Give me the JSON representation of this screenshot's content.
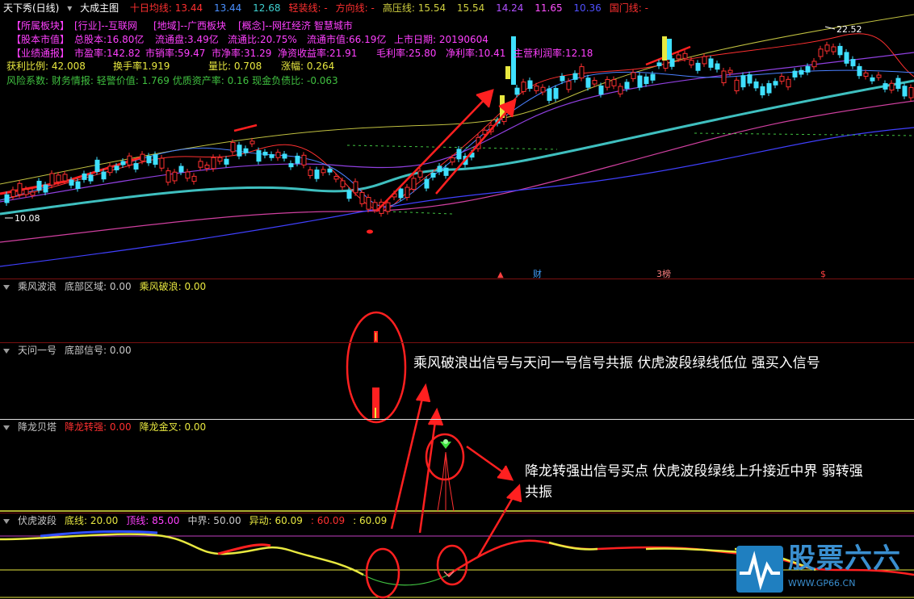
{
  "header": {
    "stock_title": "天下秀(日线)",
    "chart_name": "大成主图",
    "items": [
      {
        "label": "十日均线:",
        "value": "13.44",
        "color": "#ff3030"
      },
      {
        "label": "",
        "value": "13.44",
        "color": "#4a90ff"
      },
      {
        "label": "",
        "value": "12.68",
        "color": "#3fd0d0"
      },
      {
        "label": "轻装线:",
        "value": "-",
        "color": "#ff3030"
      },
      {
        "label": "方向线:",
        "value": "-",
        "color": "#ff3030"
      },
      {
        "label": "高压线:",
        "value": "15.54",
        "color": "#d0d040"
      },
      {
        "label": "",
        "value": "15.54",
        "color": "#d0d040"
      },
      {
        "label": "",
        "value": "14.24",
        "color": "#b050ff"
      },
      {
        "label": "",
        "value": "11.65",
        "color": "#ff50ff"
      },
      {
        "label": "",
        "value": "10.36",
        "color": "#5050ff"
      },
      {
        "label": "国门线:",
        "value": "-",
        "color": "#ff3030"
      }
    ]
  },
  "info_rows": [
    [
      {
        "text": "【所属板块】",
        "color": "#ff40ff"
      },
      {
        "text": "[行业]--互联网",
        "color": "#ff40ff"
      },
      {
        "text": "[地域]--广西板块",
        "color": "#ff40ff"
      },
      {
        "text": "[概念]--网红经济 智慧城市",
        "color": "#ff40ff"
      }
    ],
    [
      {
        "text": "【股本市值】",
        "color": "#ff40ff"
      },
      {
        "text": "总股本:16.80亿",
        "color": "#ff40ff"
      },
      {
        "text": "流通盘:3.49亿",
        "color": "#ff40ff"
      },
      {
        "text": "流通比:20.75%",
        "color": "#ff40ff"
      },
      {
        "text": "流通市值:66.19亿",
        "color": "#ff40ff"
      },
      {
        "text": "上市日期: 20190604",
        "color": "#ff40ff"
      }
    ],
    [
      {
        "text": "【业绩通报】",
        "color": "#ff40ff"
      },
      {
        "text": "市盈率:142.82",
        "color": "#ff40ff"
      },
      {
        "text": "市销率:59.47",
        "color": "#ff40ff"
      },
      {
        "text": "市净率:31.29",
        "color": "#ff40ff"
      },
      {
        "text": "净资收益率:21.91",
        "color": "#ff40ff"
      },
      {
        "text": "毛利率:25.80",
        "color": "#ff40ff"
      },
      {
        "text": "净利率:10.41",
        "color": "#ff40ff"
      },
      {
        "text": "主营利润率:12.18",
        "color": "#ff40ff"
      }
    ],
    [
      {
        "text": "获利比例:  42.008",
        "color": "#e8e840"
      },
      {
        "text": "换手率1.919",
        "color": "#e8e840"
      },
      {
        "text": "量比:  0.708",
        "color": "#e8e840"
      },
      {
        "text": "涨幅:  0.264",
        "color": "#e8e840"
      }
    ],
    [
      {
        "text": "风险系数: 财务情报: 轻警价值: 1.769 优质资产率: 0.16 现金负债比: -0.063",
        "color": "#40c040"
      }
    ]
  ],
  "price_labels": {
    "high": "22.52",
    "low": "10.08"
  },
  "event_markers": {
    "cai": "财",
    "bang": "3榜",
    "dollar": "$"
  },
  "panels": {
    "p1": {
      "name": "乘风波浪",
      "items": [
        {
          "text": "底部区域: 0.00",
          "color": "#c8c8c8"
        },
        {
          "text": "乘风破浪: 0.00",
          "color": "#e8e840"
        }
      ]
    },
    "p2": {
      "name": "天问一号",
      "items": [
        {
          "text": "底部信号: 0.00",
          "color": "#c8c8c8"
        }
      ]
    },
    "p3": {
      "name": "降龙贝塔",
      "items": [
        {
          "text": "降龙转强: 0.00",
          "color": "#ff3030"
        },
        {
          "text": "降龙金叉: 0.00",
          "color": "#e8e840"
        }
      ]
    },
    "p4": {
      "name": "伏虎波段",
      "items": [
        {
          "text": "底线: 20.00",
          "color": "#e8e840"
        },
        {
          "text": "顶线: 85.00",
          "color": "#ff40ff"
        },
        {
          "text": "中界: 50.00",
          "color": "#c8c8c8"
        },
        {
          "text": "异动: 60.09",
          "color": "#e8e840"
        },
        {
          "text": ": 60.09",
          "color": "#ff3030"
        },
        {
          "text": ": 60.09",
          "color": "#e8e840"
        }
      ]
    }
  },
  "annotations": {
    "a1": "乘风破浪出信号与天问一号信号共振 伏虎波段绿线低位 强买入信号",
    "a2_line1": "降龙转强出信号买点 伏虎波段绿线上升接近中界 弱转强",
    "a2_line2": "共振"
  },
  "watermark": {
    "brand": "股票六六",
    "site": "WWW.GP66.CN"
  }
}
